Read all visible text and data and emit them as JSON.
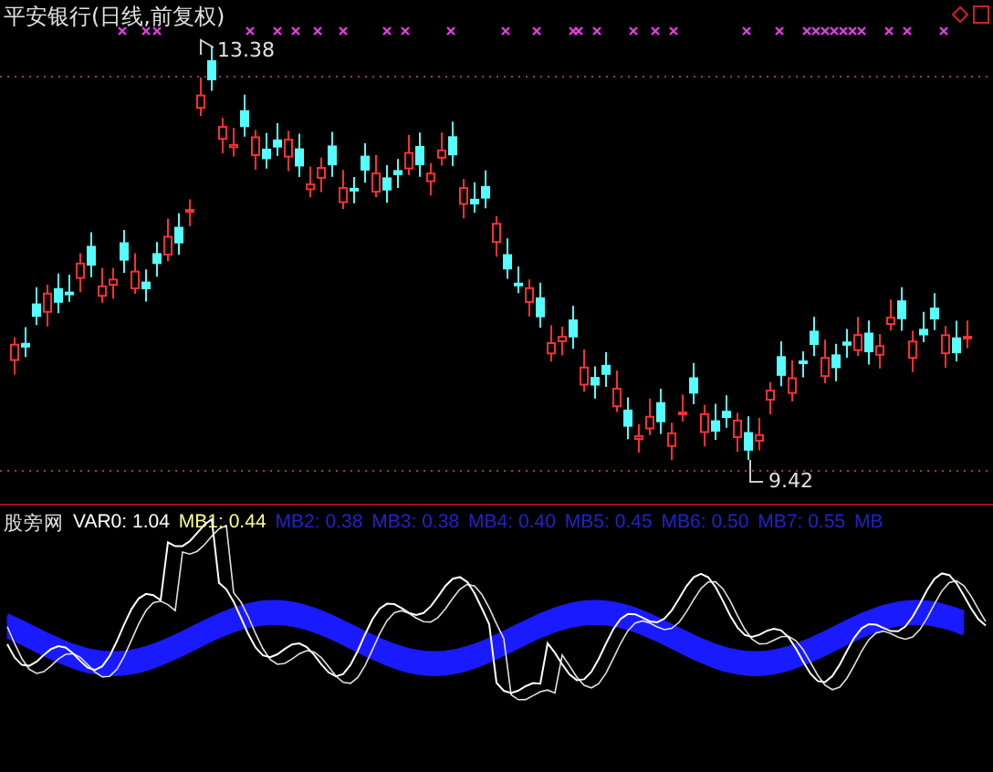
{
  "price_panel": {
    "title": "平安银行(日线,前复权)",
    "high_label": "13.38",
    "low_label": "9.42"
  },
  "indicator_panel": {
    "name": "股旁网",
    "indicators": [
      {
        "text": "VAR0: 1.04",
        "color": "#ffffff"
      },
      {
        "text": "MB1: 0.44",
        "color": "#ffff80"
      },
      {
        "text": "MB2: 0.38",
        "color": "#2222cc"
      },
      {
        "text": "MB3: 0.38",
        "color": "#2222cc"
      },
      {
        "text": "MB4: 0.40",
        "color": "#2222cc"
      },
      {
        "text": "MB5: 0.45",
        "color": "#2222cc"
      },
      {
        "text": "MB6: 0.50",
        "color": "#2222cc"
      },
      {
        "text": "MB7: 0.55",
        "color": "#2222cc"
      },
      {
        "text": "MB",
        "color": "#2222cc"
      }
    ]
  }
}
